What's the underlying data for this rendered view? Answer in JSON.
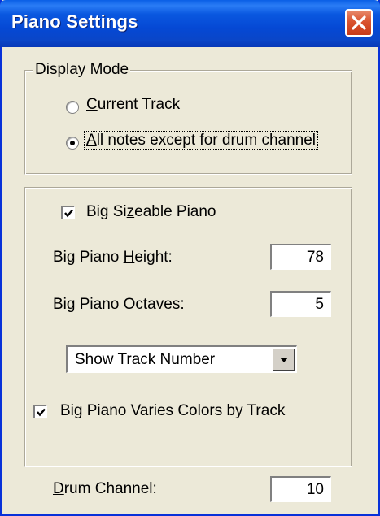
{
  "window": {
    "title": "Piano Settings",
    "close_icon": "close-icon"
  },
  "display_mode": {
    "legend": "Display Mode",
    "options": [
      {
        "prefix": "",
        "accel": "C",
        "rest": "urrent Track",
        "selected": false
      },
      {
        "prefix": "",
        "accel": "A",
        "rest": "ll notes except for drum channel",
        "selected": true
      }
    ]
  },
  "big_piano": {
    "checkbox": {
      "prefix": "Big Si",
      "accel": "z",
      "rest": "eable Piano",
      "checked": true
    },
    "height": {
      "prefix": "Big Piano ",
      "accel": "H",
      "rest": "eight:",
      "value": "78"
    },
    "octaves": {
      "prefix": "Big Piano ",
      "accel": "O",
      "rest": "ctaves:",
      "value": "5"
    },
    "track_display": {
      "value": "Show Track Number"
    },
    "varies_colors": {
      "label": "Big Piano Varies Colors by Track",
      "checked": true
    }
  },
  "drum": {
    "prefix": "",
    "accel": "D",
    "rest": "rum Channel:",
    "value": "10"
  }
}
